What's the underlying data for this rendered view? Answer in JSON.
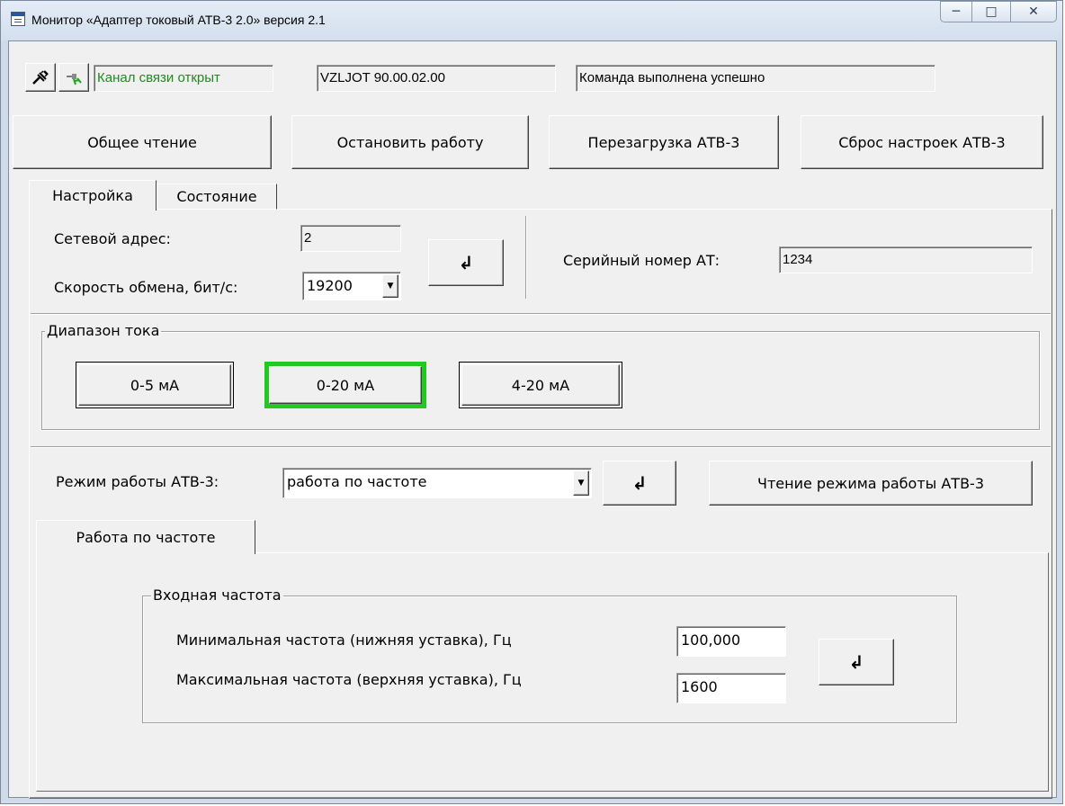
{
  "window": {
    "title": "Монитор «Адаптер токовый АТВ-3 2.0» версия 2.1",
    "minimize_glyph": "─",
    "maximize_glyph": "□",
    "close_glyph": "✕"
  },
  "status": {
    "connection": "Канал связи открыт",
    "connection_color": "#1f8a1f",
    "device_version": "VZLJOT 90.00.02.00",
    "message": "Команда выполнена успешно"
  },
  "toolbar": {
    "read_all": "Общее чтение",
    "stop": "Остановить работу",
    "reboot": "Перезагрузка АТВ-3",
    "reset": "Сброс настроек АТВ-3"
  },
  "tabs": {
    "settings": "Настройка",
    "state": "Состояние"
  },
  "settings": {
    "address_label": "Сетевой адрес:",
    "address_value": "2",
    "speed_label": "Скорость обмена, бит/с:",
    "speed_value": "19200",
    "apply_glyph": "↲",
    "serial_label": "Серийный номер АТ:",
    "serial_value": "1234"
  },
  "current_range": {
    "title": "Диапазон тока",
    "options": [
      "0-5 мА",
      "0-20 мА",
      "4-20 мА"
    ],
    "selected": "0-20 мА",
    "selected_color": "#22c922"
  },
  "mode": {
    "label": "Режим работы АТВ-3:",
    "value": "работа по частоте",
    "apply_glyph": "↲",
    "read_button": "Чтение режима работы АТВ-3"
  },
  "mode_tab": {
    "label": "Работа по частоте"
  },
  "frequency": {
    "title": "Входная частота",
    "min_label": "Минимальная частота (нижняя уставка), Гц",
    "min_value": "100,000",
    "max_label": "Максимальная частота (верхняя уставка), Гц",
    "max_value": "1600",
    "apply_glyph": "↲"
  }
}
